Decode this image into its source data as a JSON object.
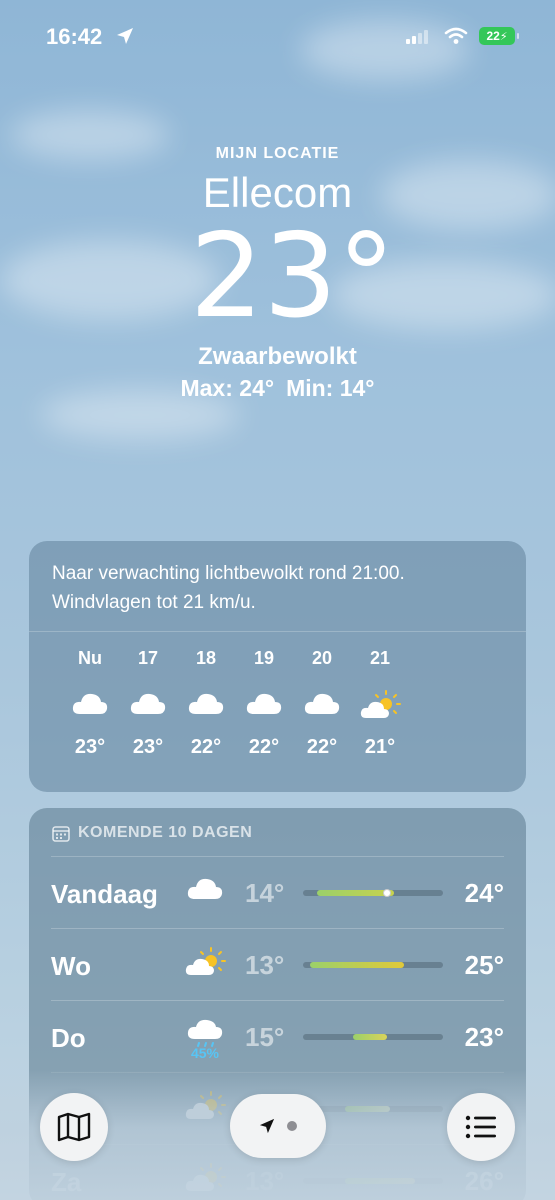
{
  "status_bar": {
    "time": "16:42",
    "battery": "22"
  },
  "header": {
    "my_location": "MIJN LOCATIE",
    "city": "Ellecom",
    "temperature": "23°",
    "condition": "Zwaarbewolkt",
    "max": "Max: 24°",
    "min": "Min: 14°"
  },
  "hourly": {
    "summary": "Naar verwachting lichtbewolkt rond 21:00. Windvlagen tot 21 km/u.",
    "items": [
      {
        "label": "Nu",
        "icon": "cloud-icon",
        "temp": "23°"
      },
      {
        "label": "17",
        "icon": "cloud-icon",
        "temp": "23°"
      },
      {
        "label": "18",
        "icon": "cloud-icon",
        "temp": "22°"
      },
      {
        "label": "19",
        "icon": "cloud-icon",
        "temp": "22°"
      },
      {
        "label": "20",
        "icon": "cloud-icon",
        "temp": "22°"
      },
      {
        "label": "21",
        "icon": "partly-sunny-icon",
        "temp": "21°"
      }
    ]
  },
  "forecast": {
    "title": "KOMENDE 10 DAGEN",
    "days": [
      {
        "name": "Vandaag",
        "icon": "cloud-icon",
        "precip": "",
        "min": "14°",
        "max": "24°",
        "bar_start": 0.1,
        "bar_end": 0.65,
        "current": 0.6,
        "bar_color": "#c8d24e"
      },
      {
        "name": "Wo",
        "icon": "partly-sunny-icon",
        "precip": "",
        "min": "13°",
        "max": "25°",
        "bar_start": 0.05,
        "bar_end": 0.72,
        "current": null,
        "bar_color": "#e0c93a"
      },
      {
        "name": "Do",
        "icon": "rain-icon",
        "precip": "45%",
        "min": "15°",
        "max": "23°",
        "bar_start": 0.36,
        "bar_end": 0.6,
        "current": null,
        "bar_color": "#d9d35a"
      },
      {
        "name": "",
        "icon": "partly-sunny-icon",
        "precip": "",
        "min": "",
        "max": "",
        "bar_start": 0.3,
        "bar_end": 0.62,
        "current": null,
        "bar_color": "#dfe6b0"
      },
      {
        "name": "Za",
        "icon": "partly-sunny-icon",
        "precip": "",
        "min": "13°",
        "max": "26°",
        "bar_start": 0.3,
        "bar_end": 0.8,
        "current": null,
        "bar_color": "#e8d98a"
      }
    ]
  },
  "colors": {
    "accent_precip": "#57c5f5",
    "battery": "#34c759"
  }
}
